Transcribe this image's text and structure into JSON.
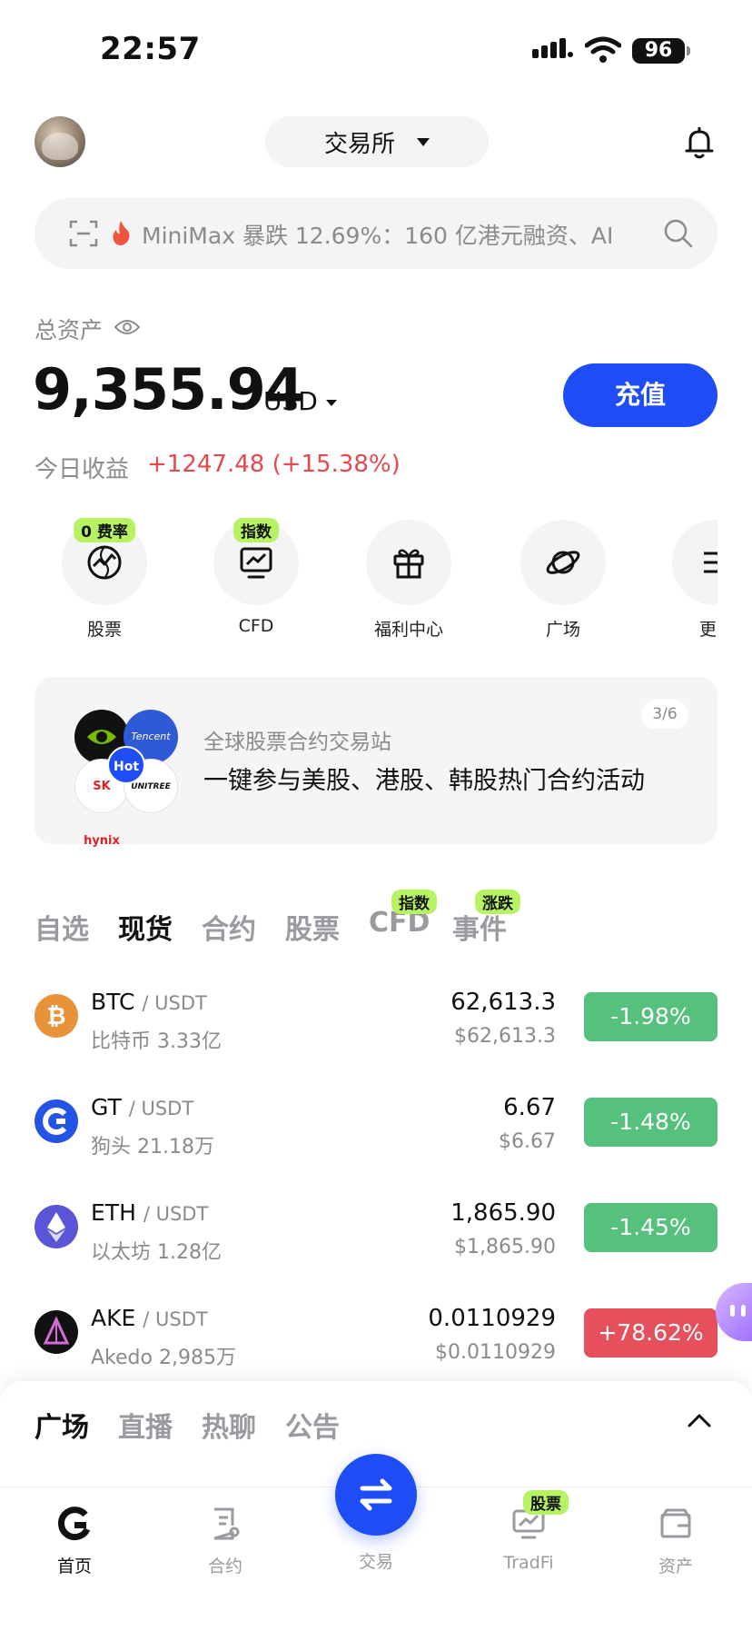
{
  "status_bar": {
    "time": "22:57",
    "battery": "96"
  },
  "header": {
    "exchange_label": "交易所"
  },
  "search": {
    "text": "MiniMax 暴跌 12.69%：160 亿港元融资、AI"
  },
  "assets": {
    "label": "总资产",
    "value": "9,355.94",
    "currency": "USD",
    "deposit_label": "充值",
    "today_label": "今日收益",
    "today_value": "+1247.48 (+15.38%)"
  },
  "shortcuts": [
    {
      "label": "股票",
      "badge": "0 费率",
      "icon": "globe-chart-icon"
    },
    {
      "label": "CFD",
      "badge": "指数",
      "icon": "monitor-chart-icon"
    },
    {
      "label": "福利中心",
      "badge": "",
      "icon": "gift-icon"
    },
    {
      "label": "广场",
      "badge": "",
      "icon": "planet-icon"
    },
    {
      "label": "更",
      "badge": "",
      "icon": "more-icon"
    }
  ],
  "banner": {
    "title": "全球股票合约交易站",
    "text": "一键参与美股、港股、韩股热门合约活动",
    "page": "3/6",
    "hot": "Hot",
    "logo_tencent": "Tencent",
    "logo_sk": "SK hynix",
    "logo_unitree": "UNITREE"
  },
  "market_tabs": [
    {
      "label": "自选",
      "badge": ""
    },
    {
      "label": "现货",
      "badge": "",
      "active": true
    },
    {
      "label": "合约",
      "badge": ""
    },
    {
      "label": "股票",
      "badge": ""
    },
    {
      "label": "CFD",
      "badge": "指数"
    },
    {
      "label": "事件",
      "badge": "涨跌"
    }
  ],
  "market_rows": [
    {
      "base": "BTC",
      "quote": "/ USDT",
      "sub": "比特币 3.33亿",
      "price": "62,613.3",
      "price_usd": "$62,613.3",
      "change": "-1.98%",
      "direction": "down",
      "icon": "btc-icon",
      "color": "#e8923a"
    },
    {
      "base": "GT",
      "quote": "/ USDT",
      "sub": "狗头 21.18万",
      "price": "6.67",
      "price_usd": "$6.67",
      "change": "-1.48%",
      "direction": "down",
      "icon": "gt-icon",
      "color": "#2354e6"
    },
    {
      "base": "ETH",
      "quote": "/ USDT",
      "sub": "以太坊 1.28亿",
      "price": "1,865.90",
      "price_usd": "$1,865.90",
      "change": "-1.45%",
      "direction": "down",
      "icon": "eth-icon",
      "color": "#5a55d6"
    },
    {
      "base": "AKE",
      "quote": "/ USDT",
      "sub": "Akedo 2,985万",
      "price": "0.0110929",
      "price_usd": "$0.0110929",
      "change": "+78.62%",
      "direction": "up",
      "icon": "ake-icon",
      "color": "#111111"
    }
  ],
  "social_tabs": [
    {
      "label": "广场",
      "active": true
    },
    {
      "label": "直播"
    },
    {
      "label": "热聊"
    },
    {
      "label": "公告"
    }
  ],
  "bottom_nav": [
    {
      "label": "首页",
      "icon": "home-icon",
      "active": true
    },
    {
      "label": "合约",
      "icon": "contract-icon"
    },
    {
      "label": "交易",
      "icon": "swap-icon"
    },
    {
      "label": "TradFi",
      "icon": "tradfi-icon",
      "badge": "股票"
    },
    {
      "label": "资产",
      "icon": "wallet-icon"
    }
  ],
  "colors": {
    "accent": "#1f4df5",
    "down": "#56c07d",
    "up": "#e5505c",
    "badge": "#b6f262"
  }
}
